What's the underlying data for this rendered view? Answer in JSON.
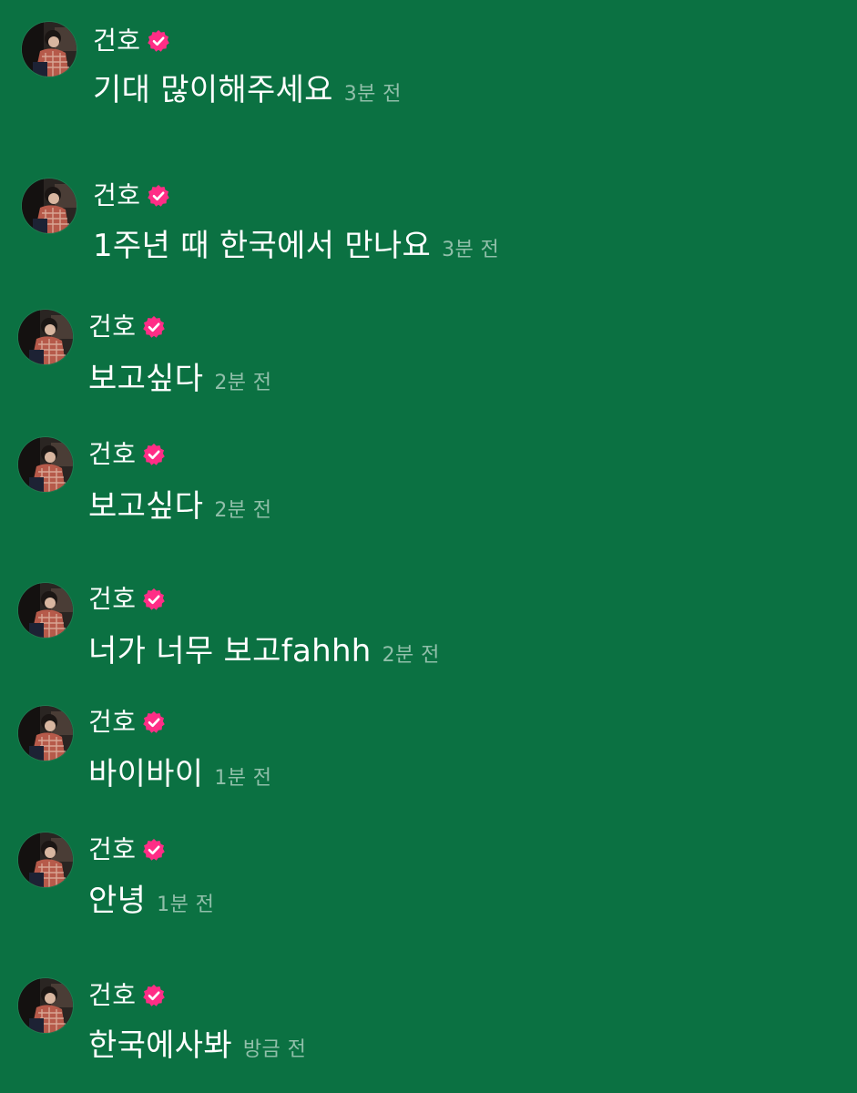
{
  "theme": {
    "background": "#0b7142",
    "verified_badge": "#ff2d86",
    "text": "#ffffff",
    "timestamp": "#8ac3a8"
  },
  "messages": [
    {
      "sender": "건호",
      "verified_icon": "pink-verified-icon",
      "text": "기대 많이해주세요",
      "time": "3분 전"
    },
    {
      "sender": "건호",
      "verified_icon": "pink-verified-icon",
      "text": "1주년 때 한국에서 만나요",
      "time": "3분 전"
    },
    {
      "sender": "건호",
      "verified_icon": "pink-verified-icon",
      "text": "보고싶다",
      "time": "2분 전"
    },
    {
      "sender": "건호",
      "verified_icon": "pink-verified-icon",
      "text": "보고싶다",
      "time": "2분 전"
    },
    {
      "sender": "건호",
      "verified_icon": "pink-verified-icon",
      "text": "너가 너무 보고fahhh",
      "time": "2분 전"
    },
    {
      "sender": "건호",
      "verified_icon": "pink-verified-icon",
      "text": "바이바이",
      "time": "1분 전"
    },
    {
      "sender": "건호",
      "verified_icon": "pink-verified-icon",
      "text": "안녕",
      "time": "1분 전"
    },
    {
      "sender": "건호",
      "verified_icon": "pink-verified-icon",
      "text": "한국에사봐",
      "time": "방금 전"
    }
  ]
}
